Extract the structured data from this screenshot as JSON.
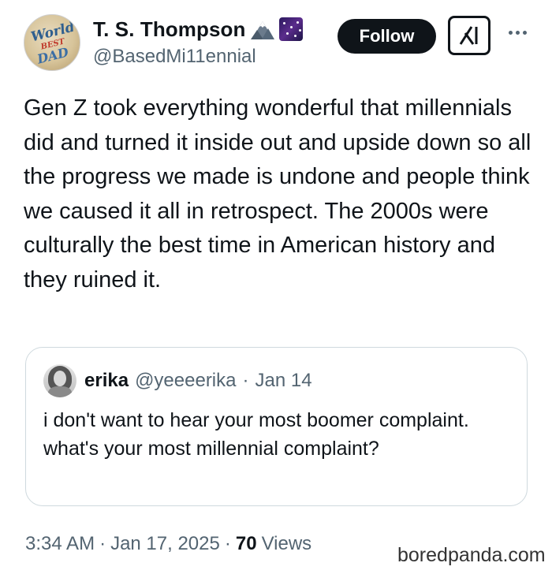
{
  "author": {
    "display_name": "T. S. Thompson",
    "handle": "@BasedMi11ennial",
    "avatar_text": [
      "World",
      "BEST",
      "DAD"
    ],
    "emojis": [
      "mountain-icon",
      "milky-way-icon"
    ]
  },
  "actions": {
    "follow_label": "Follow",
    "grok_icon": "grok-icon",
    "more_icon": "more-icon"
  },
  "tweet": {
    "text": "Gen Z took everything wonderful that millennials did and turned it inside out and upside down so all the progress we made is undone and people think we caused it all in retrospect. The 2000s were culturally the best time in American history and they ruined it."
  },
  "quote": {
    "name": "erika",
    "handle": "@yeeeerika",
    "separator": "·",
    "date": "Jan 14",
    "text": "i don't want to hear your most boomer complaint. what's your most millennial complaint?"
  },
  "meta": {
    "time": "3:34 AM",
    "separator": "·",
    "date": "Jan 17, 2025",
    "views_count": "70",
    "views_label": "Views"
  },
  "watermark": "boredpanda.com"
}
